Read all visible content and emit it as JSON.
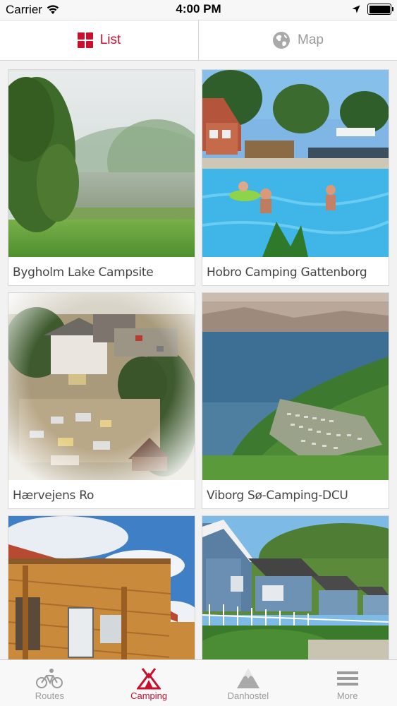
{
  "status_bar": {
    "carrier": "Carrier",
    "time": "4:00 PM",
    "icons": [
      "wifi-icon",
      "location-arrow-icon",
      "battery-icon"
    ]
  },
  "segmented": {
    "list_label": "List",
    "map_label": "Map",
    "selected": "List",
    "icons": [
      "grid-icon",
      "globe-icon"
    ]
  },
  "campsites": [
    {
      "name": "Bygholm Lake Campsite"
    },
    {
      "name": "Hobro Camping Gattenborg"
    },
    {
      "name": "Hærvejens Ro"
    },
    {
      "name": "Viborg Sø-Camping-DCU"
    },
    {
      "name": ""
    },
    {
      "name": ""
    }
  ],
  "tabbar": {
    "items": [
      {
        "label": "Routes",
        "icon": "bicycle-icon"
      },
      {
        "label": "Camping",
        "icon": "tent-icon"
      },
      {
        "label": "Danhostel",
        "icon": "mountain-icon"
      },
      {
        "label": "More",
        "icon": "menu-icon"
      }
    ],
    "active": "Camping"
  },
  "colors": {
    "accent": "#c8102e",
    "inactive": "#9b9b9b",
    "card_border": "#d7d7d7"
  }
}
